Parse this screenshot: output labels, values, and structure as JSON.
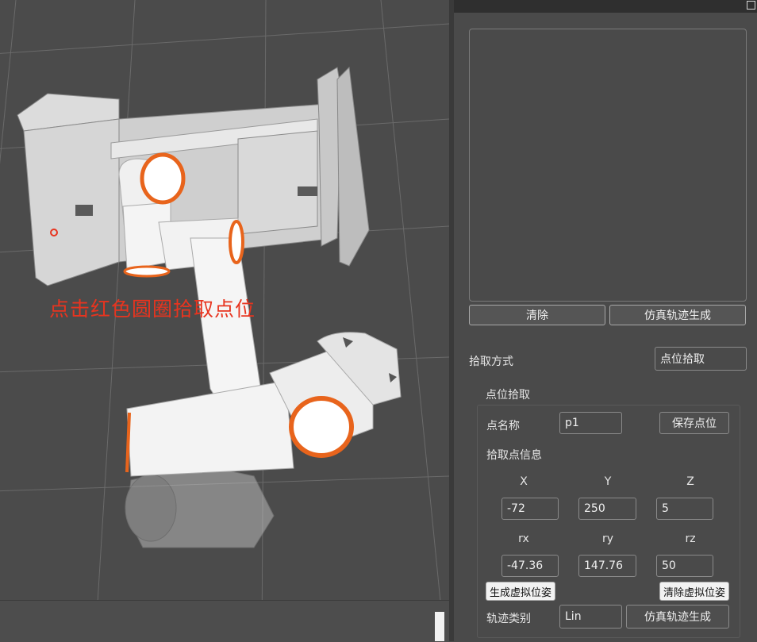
{
  "viewport": {
    "hint_text": "点击红色圆圈拾取点位"
  },
  "panel": {
    "clear_button": "清除",
    "simulate_button": "仿真轨迹生成",
    "pick_method_label": "拾取方式",
    "pick_method_value": "点位拾取",
    "group_title": "点位拾取",
    "point_name_label": "点名称",
    "point_name_value": "p1",
    "save_point_button": "保存点位",
    "pick_info_label": "拾取点信息",
    "pos": {
      "x_label": "X",
      "y_label": "Y",
      "z_label": "Z",
      "x": "-72",
      "y": "250",
      "z": "5"
    },
    "rot": {
      "rx_label": "rx",
      "ry_label": "ry",
      "rz_label": "rz",
      "rx": "-47.36",
      "ry": "147.76",
      "rz": "50"
    },
    "gen_virtual_button": "生成虚拟位姿",
    "clear_virtual_button": "清除虚拟位姿",
    "traj_type_label": "轨迹类别",
    "traj_type_value": "Lin",
    "simulate_button2": "仿真轨迹生成"
  },
  "colors": {
    "accent_orange": "#e8641c",
    "hint_red": "#e8341f"
  }
}
